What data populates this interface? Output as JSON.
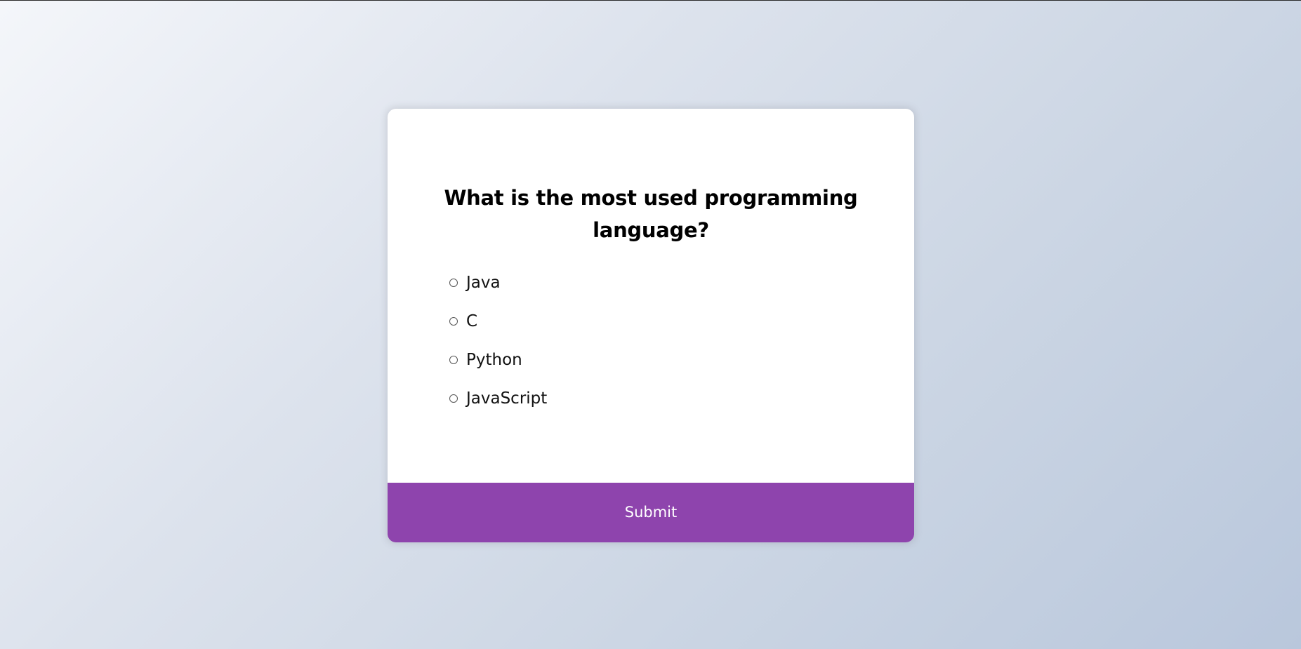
{
  "quiz": {
    "question": "What is the most used programming language?",
    "answers": [
      {
        "label": "Java",
        "selected": false
      },
      {
        "label": "C",
        "selected": false
      },
      {
        "label": "Python",
        "selected": false
      },
      {
        "label": "JavaScript",
        "selected": false
      }
    ],
    "submit_label": "Submit"
  },
  "colors": {
    "accent": "#8e44ad",
    "card_background": "#ffffff"
  }
}
